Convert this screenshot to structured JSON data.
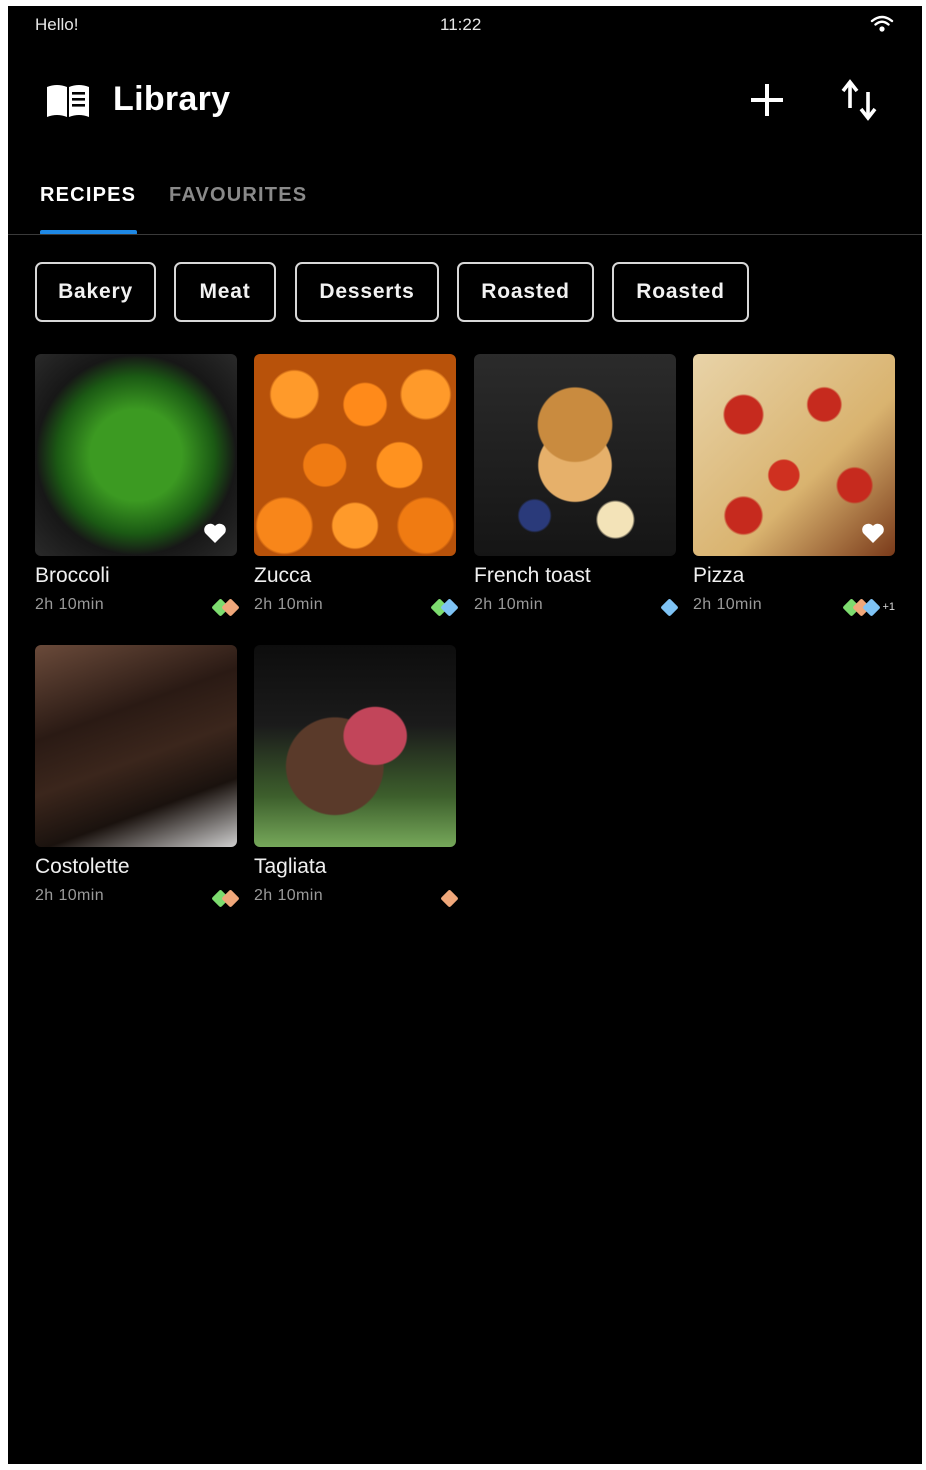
{
  "status_bar": {
    "greeting": "Hello!",
    "time": "11:22"
  },
  "app_bar": {
    "title": "Library"
  },
  "tabs": [
    {
      "label": "RECIPES",
      "active": true
    },
    {
      "label": "FAVOURITES",
      "active": false
    }
  ],
  "filters": [
    "Bakery",
    "Meat",
    "Desserts",
    "Roasted",
    "Roasted"
  ],
  "tag_colors": {
    "green": "#7ddc6f",
    "orange": "#f0a77a",
    "blue": "#7ec3f5"
  },
  "accent_color": "#1e88e5",
  "recipes": [
    {
      "name": "Broccoli",
      "time": "2h 10min",
      "favourite": true,
      "tags": [
        "green",
        "orange"
      ],
      "more": ""
    },
    {
      "name": "Zucca",
      "time": "2h 10min",
      "favourite": false,
      "tags": [
        "green",
        "blue"
      ],
      "more": ""
    },
    {
      "name": "French toast",
      "time": "2h 10min",
      "favourite": false,
      "tags": [
        "blue"
      ],
      "more": ""
    },
    {
      "name": "Pizza",
      "time": "2h 10min",
      "favourite": true,
      "tags": [
        "green",
        "orange",
        "blue"
      ],
      "more": "+1"
    },
    {
      "name": "Costolette",
      "time": "2h 10min",
      "favourite": false,
      "tags": [
        "green",
        "orange"
      ],
      "more": ""
    },
    {
      "name": "Tagliata",
      "time": "2h 10min",
      "favourite": false,
      "tags": [
        "orange"
      ],
      "more": ""
    }
  ]
}
